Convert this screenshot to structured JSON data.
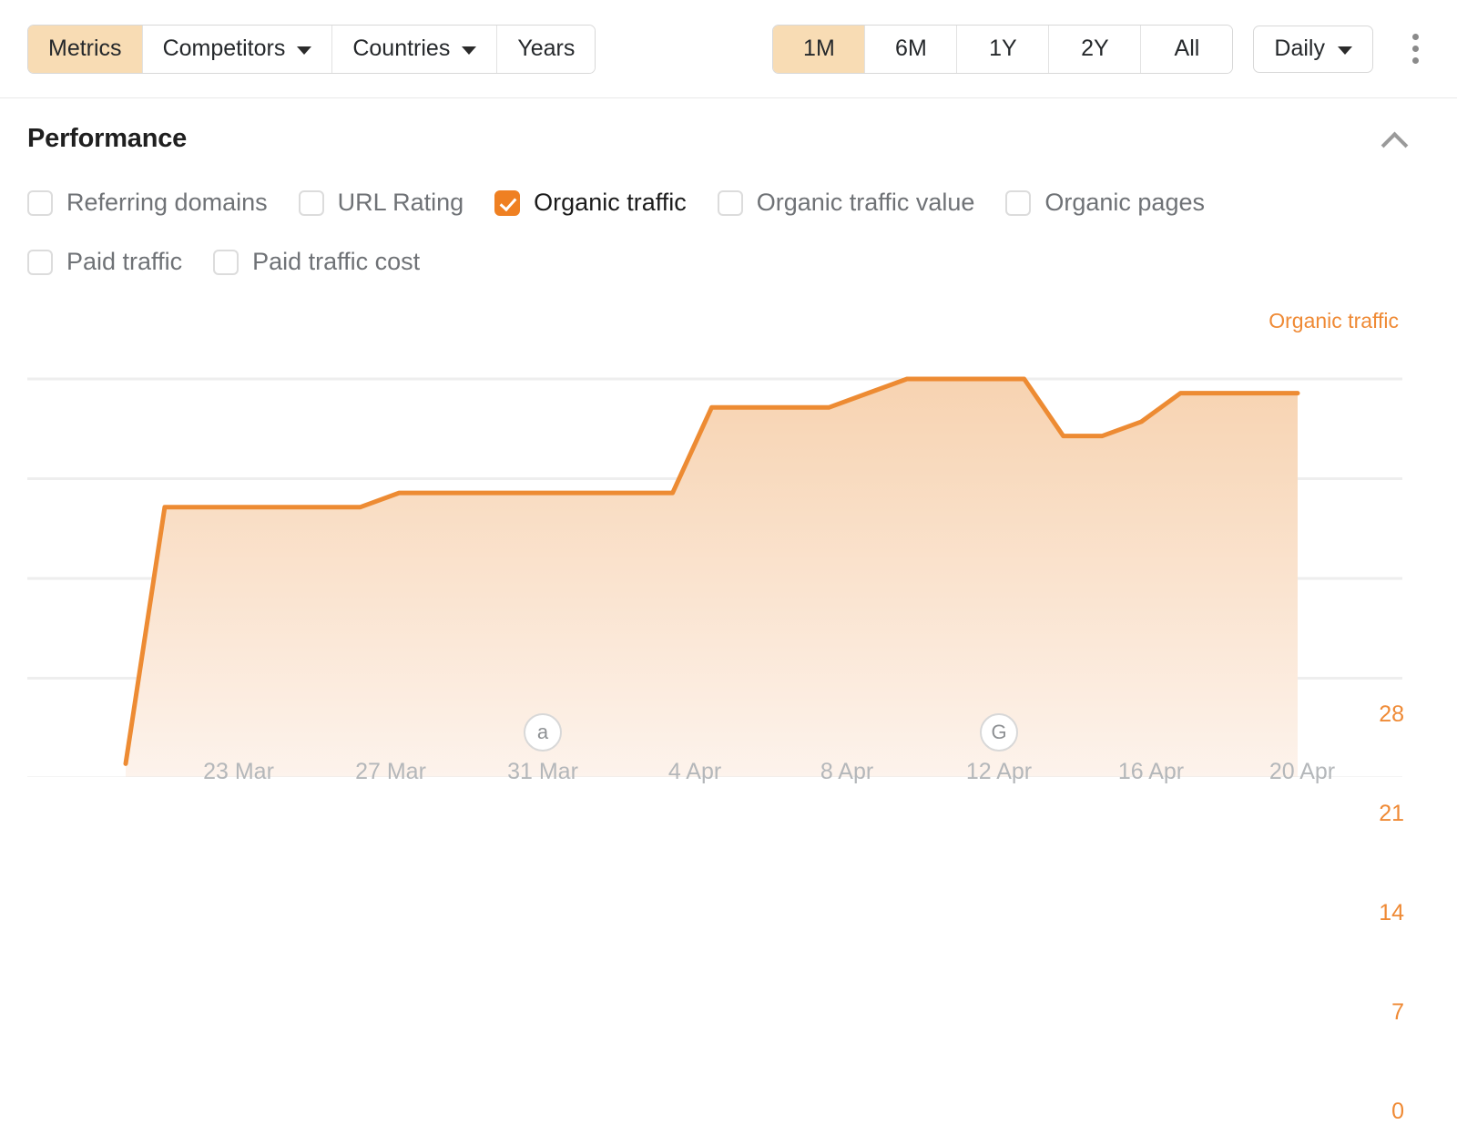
{
  "toolbar": {
    "tabs": [
      {
        "label": "Metrics",
        "active": true,
        "caret": false
      },
      {
        "label": "Competitors",
        "active": false,
        "caret": true
      },
      {
        "label": "Countries",
        "active": false,
        "caret": true
      },
      {
        "label": "Years",
        "active": false,
        "caret": false
      }
    ],
    "ranges": [
      {
        "label": "1M",
        "active": true
      },
      {
        "label": "6M",
        "active": false
      },
      {
        "label": "1Y",
        "active": false
      },
      {
        "label": "2Y",
        "active": false
      },
      {
        "label": "All",
        "active": false
      }
    ],
    "granularity": "Daily",
    "menu_icon": "kebab-menu-icon"
  },
  "section": {
    "title": "Performance",
    "collapse_icon": "chevron-up-icon"
  },
  "metrics": {
    "row1": [
      {
        "label": "Referring domains",
        "checked": false
      },
      {
        "label": "URL Rating",
        "checked": false
      },
      {
        "label": "Organic traffic",
        "checked": true
      },
      {
        "label": "Organic traffic value",
        "checked": false
      },
      {
        "label": "Organic pages",
        "checked": false
      }
    ],
    "row2": [
      {
        "label": "Paid traffic",
        "checked": false
      },
      {
        "label": "Paid traffic cost",
        "checked": false
      }
    ]
  },
  "chart_data": {
    "type": "area",
    "title": "",
    "series_label": "Organic traffic",
    "accent_color": "#ef8a35",
    "line_color": "#ed8b33",
    "fill_color": "#fae2cd",
    "grid": true,
    "legend_position": "top-right",
    "xlabel": "",
    "ylabel": "Organic traffic",
    "ylim": [
      0,
      28
    ],
    "y_ticks": [
      28,
      21,
      14,
      7,
      0
    ],
    "x_ticks": [
      "23 Mar",
      "27 Mar",
      "31 Mar",
      "4 Apr",
      "8 Apr",
      "12 Apr",
      "16 Apr",
      "20 Apr"
    ],
    "annotations": [
      {
        "label": "a",
        "at": "31 Mar",
        "name": "ahrefs-event-marker"
      },
      {
        "label": "G",
        "at": "12 Apr",
        "name": "google-update-marker"
      }
    ],
    "x": [
      "21 Mar",
      "22 Mar",
      "23 Mar",
      "24 Mar",
      "25 Mar",
      "26 Mar",
      "27 Mar",
      "28 Mar",
      "29 Mar",
      "30 Mar",
      "31 Mar",
      "1 Apr",
      "2 Apr",
      "3 Apr",
      "4 Apr",
      "5 Apr",
      "6 Apr",
      "7 Apr",
      "8 Apr",
      "9 Apr",
      "10 Apr",
      "11 Apr",
      "12 Apr",
      "13 Apr",
      "14 Apr",
      "15 Apr",
      "16 Apr",
      "17 Apr",
      "18 Apr",
      "19 Apr",
      "20 Apr"
    ],
    "values": [
      1,
      19,
      19,
      19,
      19,
      19,
      19,
      20,
      20,
      20,
      20,
      20,
      20,
      20,
      20,
      26,
      26,
      26,
      26,
      27,
      28,
      28,
      28,
      28,
      24,
      24,
      25,
      27,
      27,
      27,
      27
    ]
  }
}
